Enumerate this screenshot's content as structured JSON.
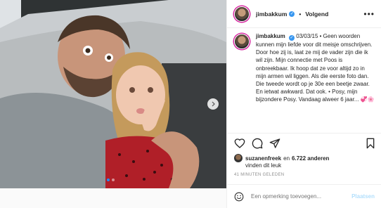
{
  "header": {
    "username": "jimbakkum",
    "follow_label": "Volgend",
    "more_label": "•••"
  },
  "caption": {
    "username": "jimbakkum",
    "date": "03/03/15",
    "text": "Geen woorden kunnen mijn liefde voor dit meisje omschrijven. Door hoe zij is, laat ze mij de vader zijn die ik wil zijn. Mijn connectie met Poos is onbreekbaar. Ik hoop dat ze voor altijd zo in mijn armen wil liggen. Als die eerste foto dan. Die tweede wordt op je 30e een beetje zwaar. En ietwat awkward. Dat ook. • Posy, mijn bijzondere Posy. Vandaag alweer 6 jaar... 💞🌸"
  },
  "likes": {
    "liker": "suzanenfreek",
    "and_label": "en",
    "others": "6.722 anderen",
    "line2": "vinden dit leuk"
  },
  "time_ago": "41 MINUTEN GELEDEN",
  "comment": {
    "placeholder": "Een opmerking toevoegen...",
    "post_label": "Plaatsen"
  },
  "icons": {
    "heart": "heart-icon",
    "comment": "comment-icon",
    "share": "share-icon",
    "save": "bookmark-icon",
    "emoji": "emoji-icon",
    "next": "chevron-right-icon"
  },
  "colors": {
    "verified": "#3897f0",
    "post_button": "#b2dffc",
    "carousel_active": "#1e90ff"
  }
}
